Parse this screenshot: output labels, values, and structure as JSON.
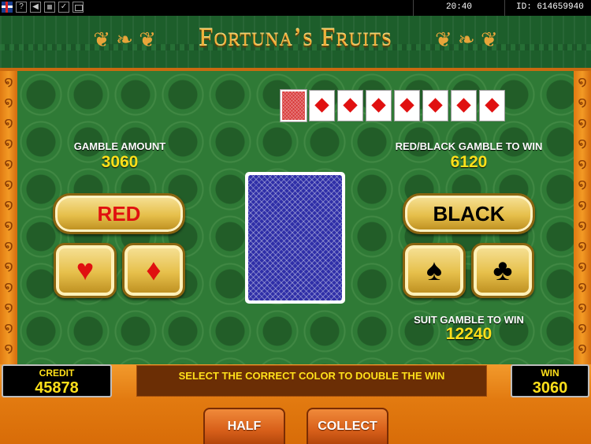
{
  "topbar": {
    "icons": [
      "flag-icon",
      "help-icon",
      "back-icon",
      "stop-icon",
      "check-icon",
      "screen-icon"
    ],
    "help_glyph": "?",
    "back_glyph": "◀",
    "check_glyph": "✓",
    "time": "20:40",
    "id": "ID: 614659940"
  },
  "title": "Fortuna’s Fruits",
  "history": {
    "first": "card-back",
    "suits": [
      "diamond",
      "diamond",
      "diamond",
      "diamond",
      "diamond",
      "diamond",
      "diamond"
    ]
  },
  "gamble_amount": {
    "label": "GAMBLE AMOUNT",
    "value": "3060"
  },
  "red_black_win": {
    "label": "RED/BLACK GAMBLE TO WIN",
    "value": "6120"
  },
  "suit_win": {
    "label": "SUIT GAMBLE TO WIN",
    "value": "12240"
  },
  "buttons": {
    "red": "RED",
    "black": "BLACK",
    "heart": "♥",
    "diamond": "♦",
    "spade": "♠",
    "club": "♣",
    "half": "HALF",
    "collect": "COLLECT"
  },
  "colors": {
    "red": "#e01010",
    "black": "#000000",
    "accent": "#ffe01a"
  },
  "credit": {
    "label": "CREDIT",
    "value": "45878"
  },
  "win": {
    "label": "WIN",
    "value": "3060"
  },
  "message": "SELECT THE CORRECT COLOR TO DOUBLE THE WIN"
}
